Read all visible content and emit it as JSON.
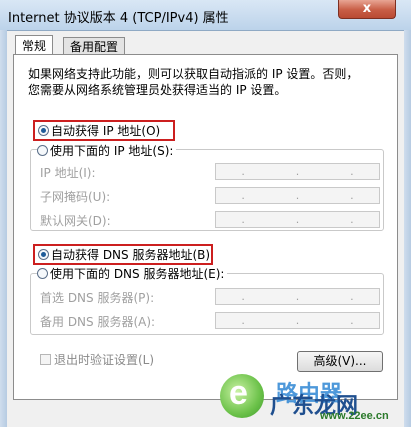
{
  "window": {
    "title": "Internet 协议版本 4 (TCP/IPv4) 属性",
    "close_glyph": "x"
  },
  "tabs": [
    {
      "label": "常规"
    },
    {
      "label": "备用配置"
    }
  ],
  "description": {
    "line1": "如果网络支持此功能，则可以获取自动指派的 IP 设置。否则，",
    "line2": "您需要从网络系统管理员处获得适当的 IP 设置。"
  },
  "ip": {
    "auto_label": "自动获得 IP 地址(O)",
    "manual_label": "使用下面的 IP 地址(S):",
    "fields": [
      {
        "label": "IP 地址(I):",
        "value": ". . ."
      },
      {
        "label": "子网掩码(U):",
        "value": ". . ."
      },
      {
        "label": "默认网关(D):",
        "value": ". . ."
      }
    ]
  },
  "dns": {
    "auto_label": "自动获得 DNS 服务器地址(B)",
    "manual_label": "使用下面的 DNS 服务器地址(E):",
    "fields": [
      {
        "label": "首选 DNS 服务器(P):",
        "value": ". . ."
      },
      {
        "label": "备用 DNS 服务器(A):",
        "value": ". . ."
      }
    ]
  },
  "validate_label": "退出时验证设置(L)",
  "advanced_button": "高级(V)...",
  "watermark": {
    "text1": "路由器",
    "text2": "广东龙网",
    "url": "www.22ee.cn",
    "logo_letter": "e"
  },
  "colors": {
    "highlight": "#cc1f1f",
    "radio_selected": "#1f5c99"
  }
}
